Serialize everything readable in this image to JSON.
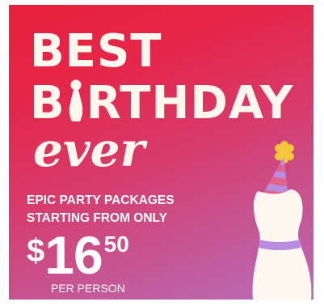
{
  "promo": {
    "headline_line1": "BEST",
    "headline_line2_start": "B",
    "headline_line2_end": "RTHDAY",
    "script_word": "ever",
    "tagline_line1": "EPIC PARTY PACKAGES",
    "tagline_line2": "STARTING FROM ONLY",
    "price": {
      "currency": "$",
      "dollars": "16",
      "cents": "50"
    },
    "price_unit": "PER PERSON"
  },
  "colors": {
    "background_top": "#e8203a",
    "background_bottom": "#b86cba",
    "text": "#fff8ee",
    "pin_body": "#fff8ee",
    "pin_stripe": "#b98ce0",
    "hat": "#b98ce0",
    "hat_stripe": "#e85a7a",
    "pompom": "#f7c73b"
  },
  "icons": {
    "letter_i_replacement": "bowling-pin-icon",
    "illustration": "bowling-pin-party-hat-icon"
  }
}
